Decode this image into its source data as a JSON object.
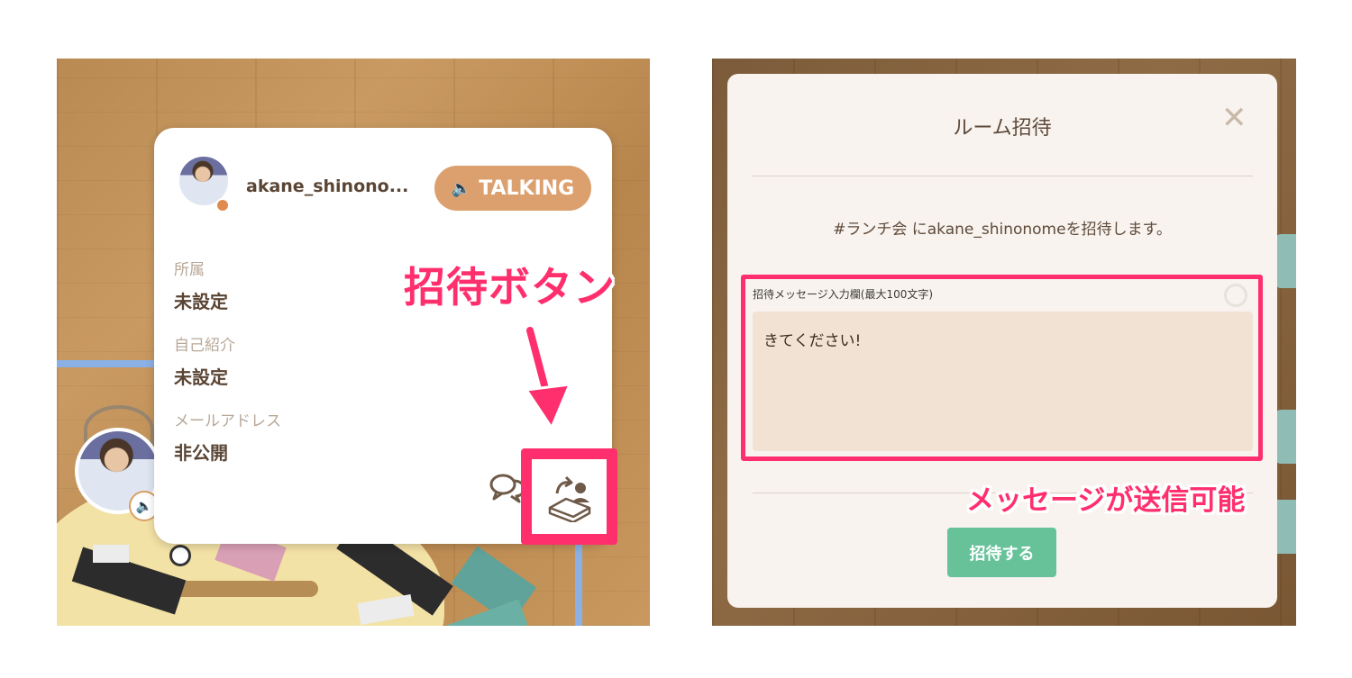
{
  "left_panel": {
    "profile": {
      "username": "akane_shinono...",
      "status_badge": "TALKING",
      "fields": [
        {
          "label": "所属",
          "value": "未設定"
        },
        {
          "label": "自己紹介",
          "value": "未設定"
        },
        {
          "label": "メールアドレス",
          "value": "非公開"
        }
      ]
    },
    "annotation": "招待ボタン",
    "icons": {
      "speaker": "speaker-icon",
      "chat": "chat-icon",
      "invite": "invite-user-icon"
    },
    "colors": {
      "highlight": "#ff2f6e",
      "talking_badge": "#dca06e",
      "text": "#5a4534"
    }
  },
  "right_panel": {
    "modal": {
      "title": "ルーム招待",
      "close_label": "✕",
      "description": "#ランチ会 にakane_shinonomeを招待します。",
      "message_field_label": "招待メッセージ入力欄(最大100文字)",
      "message_value": "きてください!",
      "submit_label": "招待する"
    },
    "annotation": "メッセージが送信可能",
    "colors": {
      "highlight": "#ff2f6e",
      "submit_button": "#67c29a",
      "textarea_bg": "#f1e2d3"
    }
  }
}
